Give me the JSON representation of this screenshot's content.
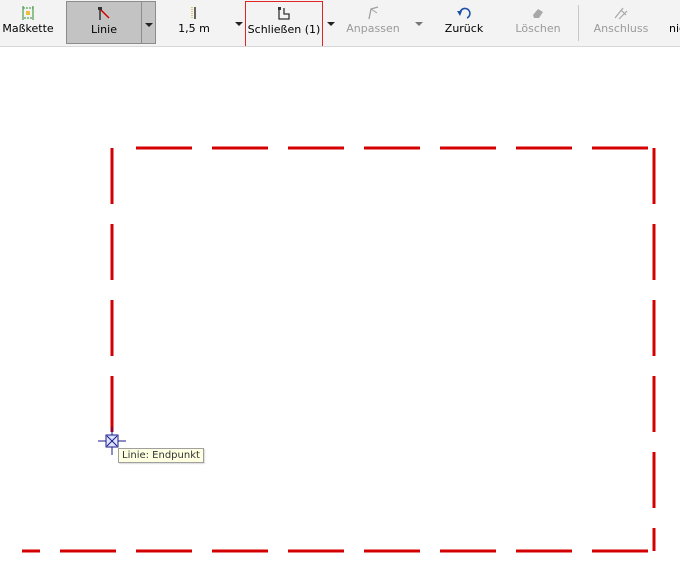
{
  "toolbar": {
    "masskette": {
      "label": "Maßkette",
      "icon": "dimension-chain-icon"
    },
    "linie": {
      "label": "Linie",
      "icon": "line-icon",
      "active": true
    },
    "line_width": {
      "label": "1,5 m",
      "icon": "line-width-icon"
    },
    "schliessen": {
      "label": "Schließen (1)",
      "icon": "close-shape-icon",
      "highlighted": true
    },
    "anpassen": {
      "label": "Anpassen",
      "icon": "adjust-icon",
      "enabled": false
    },
    "zurueck": {
      "label": "Zurück",
      "icon": "undo-icon"
    },
    "loeschen": {
      "label": "Löschen",
      "icon": "erase-icon",
      "enabled": false
    },
    "anschluss": {
      "label": "Anschluss",
      "icon": "connection-icon",
      "enabled": false
    },
    "next": {
      "label": "nic"
    }
  },
  "canvas": {
    "shape": "dashed-outline",
    "stroke_color": "#d40000",
    "cursor_icon": "snap-crosshair-icon"
  },
  "tooltip": {
    "text": "Linie: Endpunkt"
  },
  "colors": {
    "toolbar_bg": "#f3f3f3",
    "active_button_bg": "#c3c3c3",
    "highlight_border": "#e02424",
    "line_red": "#d40000",
    "tooltip_bg": "#ffffe1"
  }
}
